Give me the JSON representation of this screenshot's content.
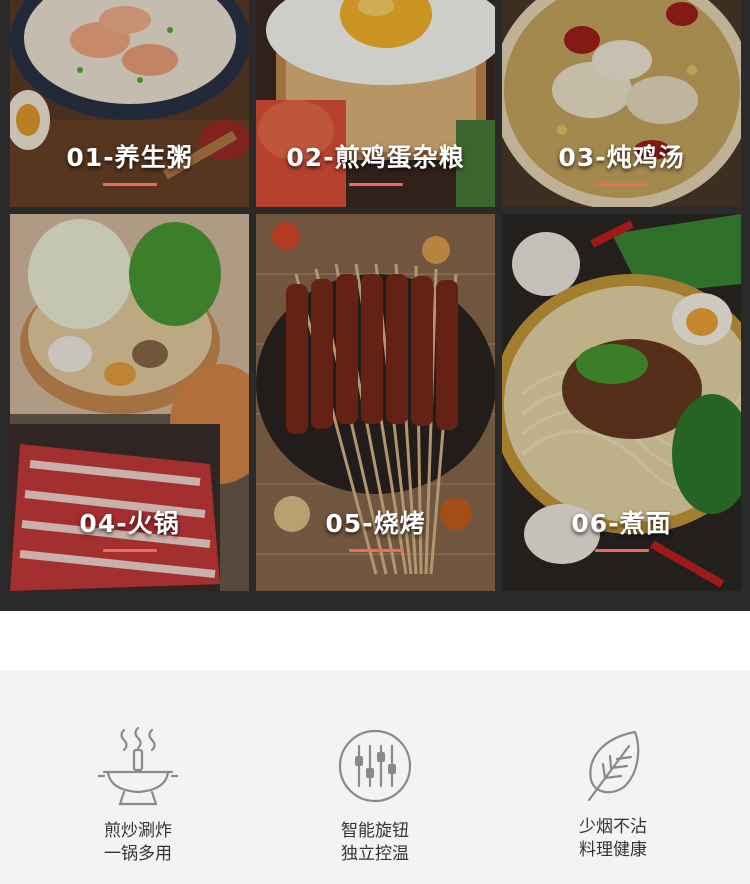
{
  "dishes": [
    {
      "label": "01-养生粥"
    },
    {
      "label": "02-煎鸡蛋杂粮"
    },
    {
      "label": "03-炖鸡汤"
    },
    {
      "label": "04-火锅"
    },
    {
      "label": "05-烧烤"
    },
    {
      "label": "06-煮面"
    }
  ],
  "features": [
    {
      "line1": "煎炒涮炸",
      "line2": "一锅多用",
      "icon": "hotpot-icon"
    },
    {
      "line1": "智能旋钮",
      "line2": "独立控温",
      "icon": "knob-sliders-icon"
    },
    {
      "line1": "少烟不沾",
      "line2": "料理健康",
      "icon": "leaf-icon"
    }
  ],
  "colors": {
    "accent": "#f06a5a",
    "dark_band": "#2a2a2a",
    "feature_bg": "#f3f3f3",
    "icon_gray": "#8a8a8a"
  }
}
